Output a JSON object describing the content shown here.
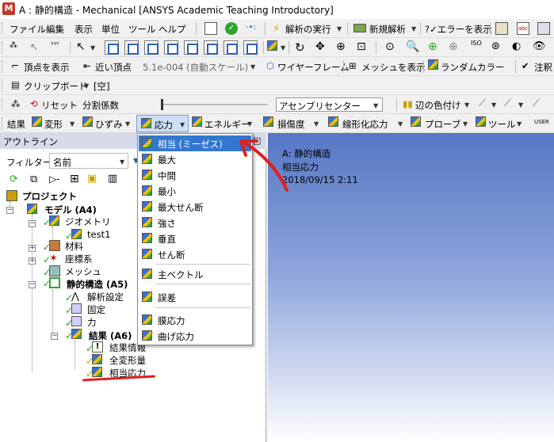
{
  "window": {
    "title": "A : 静的構造 - Mechanical [ANSYS Academic Teaching Introductory]",
    "logo_text": "M"
  },
  "menubar": {
    "items": [
      "ファイル",
      "編集",
      "表示",
      "単位",
      "ツール",
      "ヘルプ"
    ],
    "solve_label": "解析の実行",
    "new_analysis_label": "新規解析",
    "show_errors_label": "?✓エラーを表示"
  },
  "toolbar2": {},
  "toolbar3": {
    "show_vertices": "頂点を表示",
    "near_vertex": "近い頂点",
    "scale": "5.1e-004 (自動スケール)",
    "wireframe": "ワイヤーフレーム",
    "show_mesh": "メッシュを表示",
    "random_color": "ランダムカラー",
    "annotation": "注釈"
  },
  "toolbar4": {
    "clipboard": "クリップボード",
    "clipboard_value": "[空]"
  },
  "toolbar5": {
    "reset": "リセット",
    "explode_factor": "分割係数",
    "assembly_center": "アセンブリセンター",
    "edge_coloring": "辺の色付け"
  },
  "toolbar6": {
    "results": "結果",
    "deformation": "変形",
    "strain": "ひずみ",
    "stress": "応力",
    "energy": "エネルギー",
    "damage": "損傷度",
    "linearized_stress": "線形化応力",
    "probe": "プローブ",
    "tools": "ツール",
    "user": "USER"
  },
  "outline": {
    "header": "アウトライン",
    "filter_label": "フィルター:",
    "filter_value": "名前",
    "tree": {
      "project": "プロジェクト",
      "model": "モデル (A4)",
      "geometry": "ジオメトリ",
      "part": "test1",
      "materials": "材料",
      "coords": "座標系",
      "mesh": "メッシュ",
      "static": "静的構造 (A5)",
      "analysis_settings": "解析設定",
      "fixed": "固定",
      "force": "力",
      "solution": "結果 (A6)",
      "solution_info": "結果情報",
      "total_deformation": "全変形量",
      "equiv_stress": "相当応力"
    }
  },
  "graphics": {
    "line1": "A: 静的構造",
    "line2": "相当応力",
    "line3": "2018/09/15 2:11"
  },
  "stress_menu": {
    "items": [
      "相当 (ミーゼス)",
      "最大",
      "中間",
      "最小",
      "最大せん断",
      "強さ",
      "垂直",
      "せん断",
      "主ベクトル",
      "誤差",
      "膜応力",
      "曲げ応力"
    ],
    "highlighted": "相当 (ミーゼス)"
  },
  "colors": {
    "highlight": "#3377d1",
    "annotation_red": "#e0201c",
    "outline_header": "#d6dbe9"
  }
}
